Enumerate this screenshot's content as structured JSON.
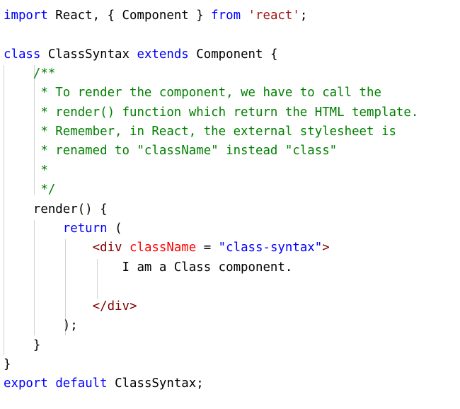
{
  "code": {
    "l1": {
      "kw1": "import",
      "t1": " React, { Component } ",
      "kw2": "from",
      "t2": " ",
      "str": "'react'",
      "t3": ";"
    },
    "l3": {
      "kw1": "class",
      "t1": " ClassSyntax ",
      "kw2": "extends",
      "t2": " Component {"
    },
    "l4": "    /**",
    "l5": "     * To render the component, we have to call the",
    "l6": "     * render() function which return the HTML template.",
    "l7": "     * Remember, in React, the external stylesheet is",
    "l8": "     * renamed to \"className\" instead \"class\"",
    "l9": "     *",
    "l10": "     */",
    "l11": "    render() {",
    "l12": {
      "indent": "        ",
      "kw": "return",
      "t": " ("
    },
    "l13": {
      "indent": "            ",
      "tag_open": "<div",
      "sp": " ",
      "attr": "className",
      "eq": " = ",
      "str": "\"class-syntax\"",
      "close": ">"
    },
    "l14": "                I am a Class component.",
    "l16": {
      "indent": "            ",
      "tag": "</div>"
    },
    "l17": "        );",
    "l18": "    }",
    "l19": "}",
    "l20": {
      "kw1": "export",
      "sp1": " ",
      "kw2": "default",
      "t": " ClassSyntax;"
    }
  }
}
